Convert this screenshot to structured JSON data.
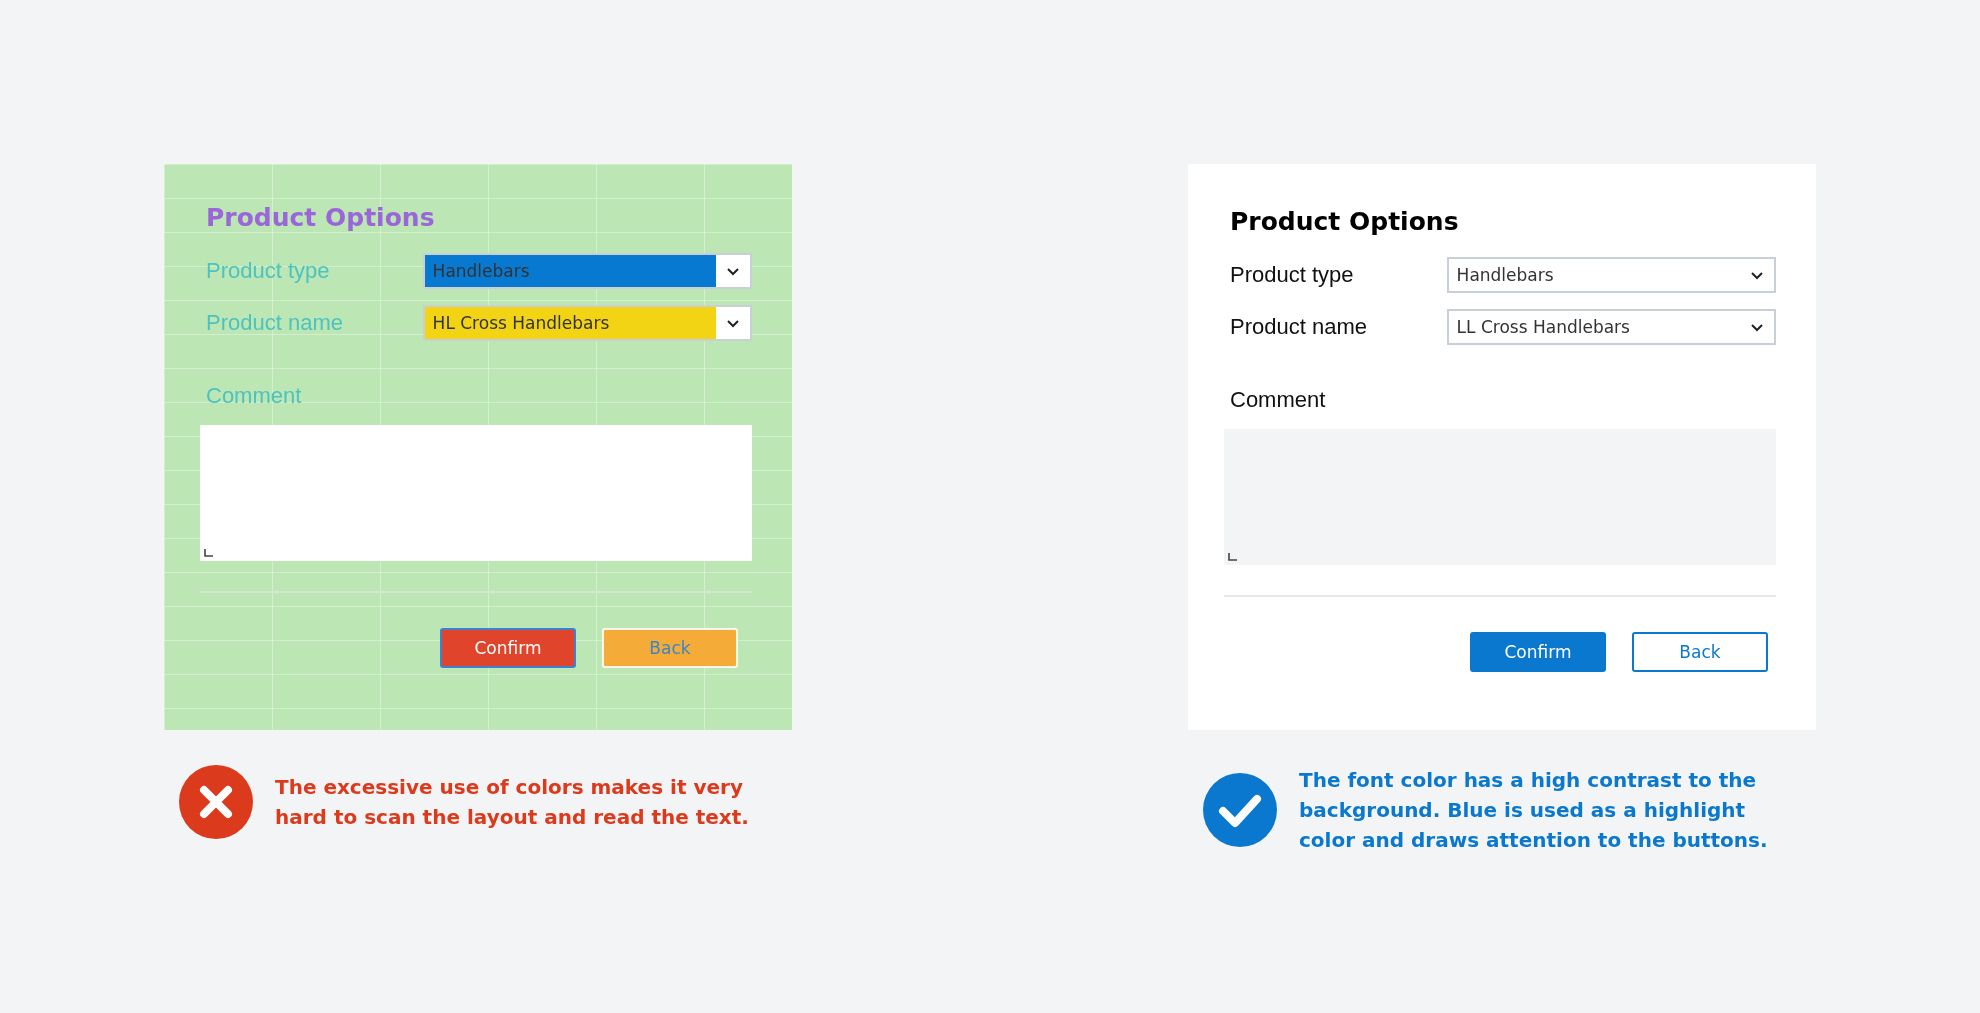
{
  "examples": [
    {
      "kind": "bad",
      "form": {
        "title": "Product Options",
        "fields": [
          {
            "label": "Product type",
            "value": "Handlebars",
            "color": "#0879d0"
          },
          {
            "label": "Product name",
            "value": "HL Cross Handlebars",
            "color": "#f3d414"
          }
        ],
        "comment_label": "Comment",
        "buttons": [
          {
            "label": "Confirm",
            "kind": "primary",
            "color": "#e0452c"
          },
          {
            "label": "Back",
            "kind": "secondary",
            "color": "#f5ab38"
          }
        ]
      },
      "verdict": "The excessive use of colors makes it very hard to scan the layout and read the text."
    },
    {
      "kind": "good",
      "form": {
        "title": "Product Options",
        "fields": [
          {
            "label": "Product type",
            "value": "Handlebars"
          },
          {
            "label": "Product name",
            "value": "LL Cross Handlebars"
          }
        ],
        "comment_label": "Comment",
        "buttons": [
          {
            "label": "Confirm",
            "kind": "primary"
          },
          {
            "label": "Back",
            "kind": "secondary"
          }
        ]
      },
      "verdict": "The font color has a high contrast to the background. Blue is used as a highlight color and draws attention to the buttons."
    }
  ]
}
